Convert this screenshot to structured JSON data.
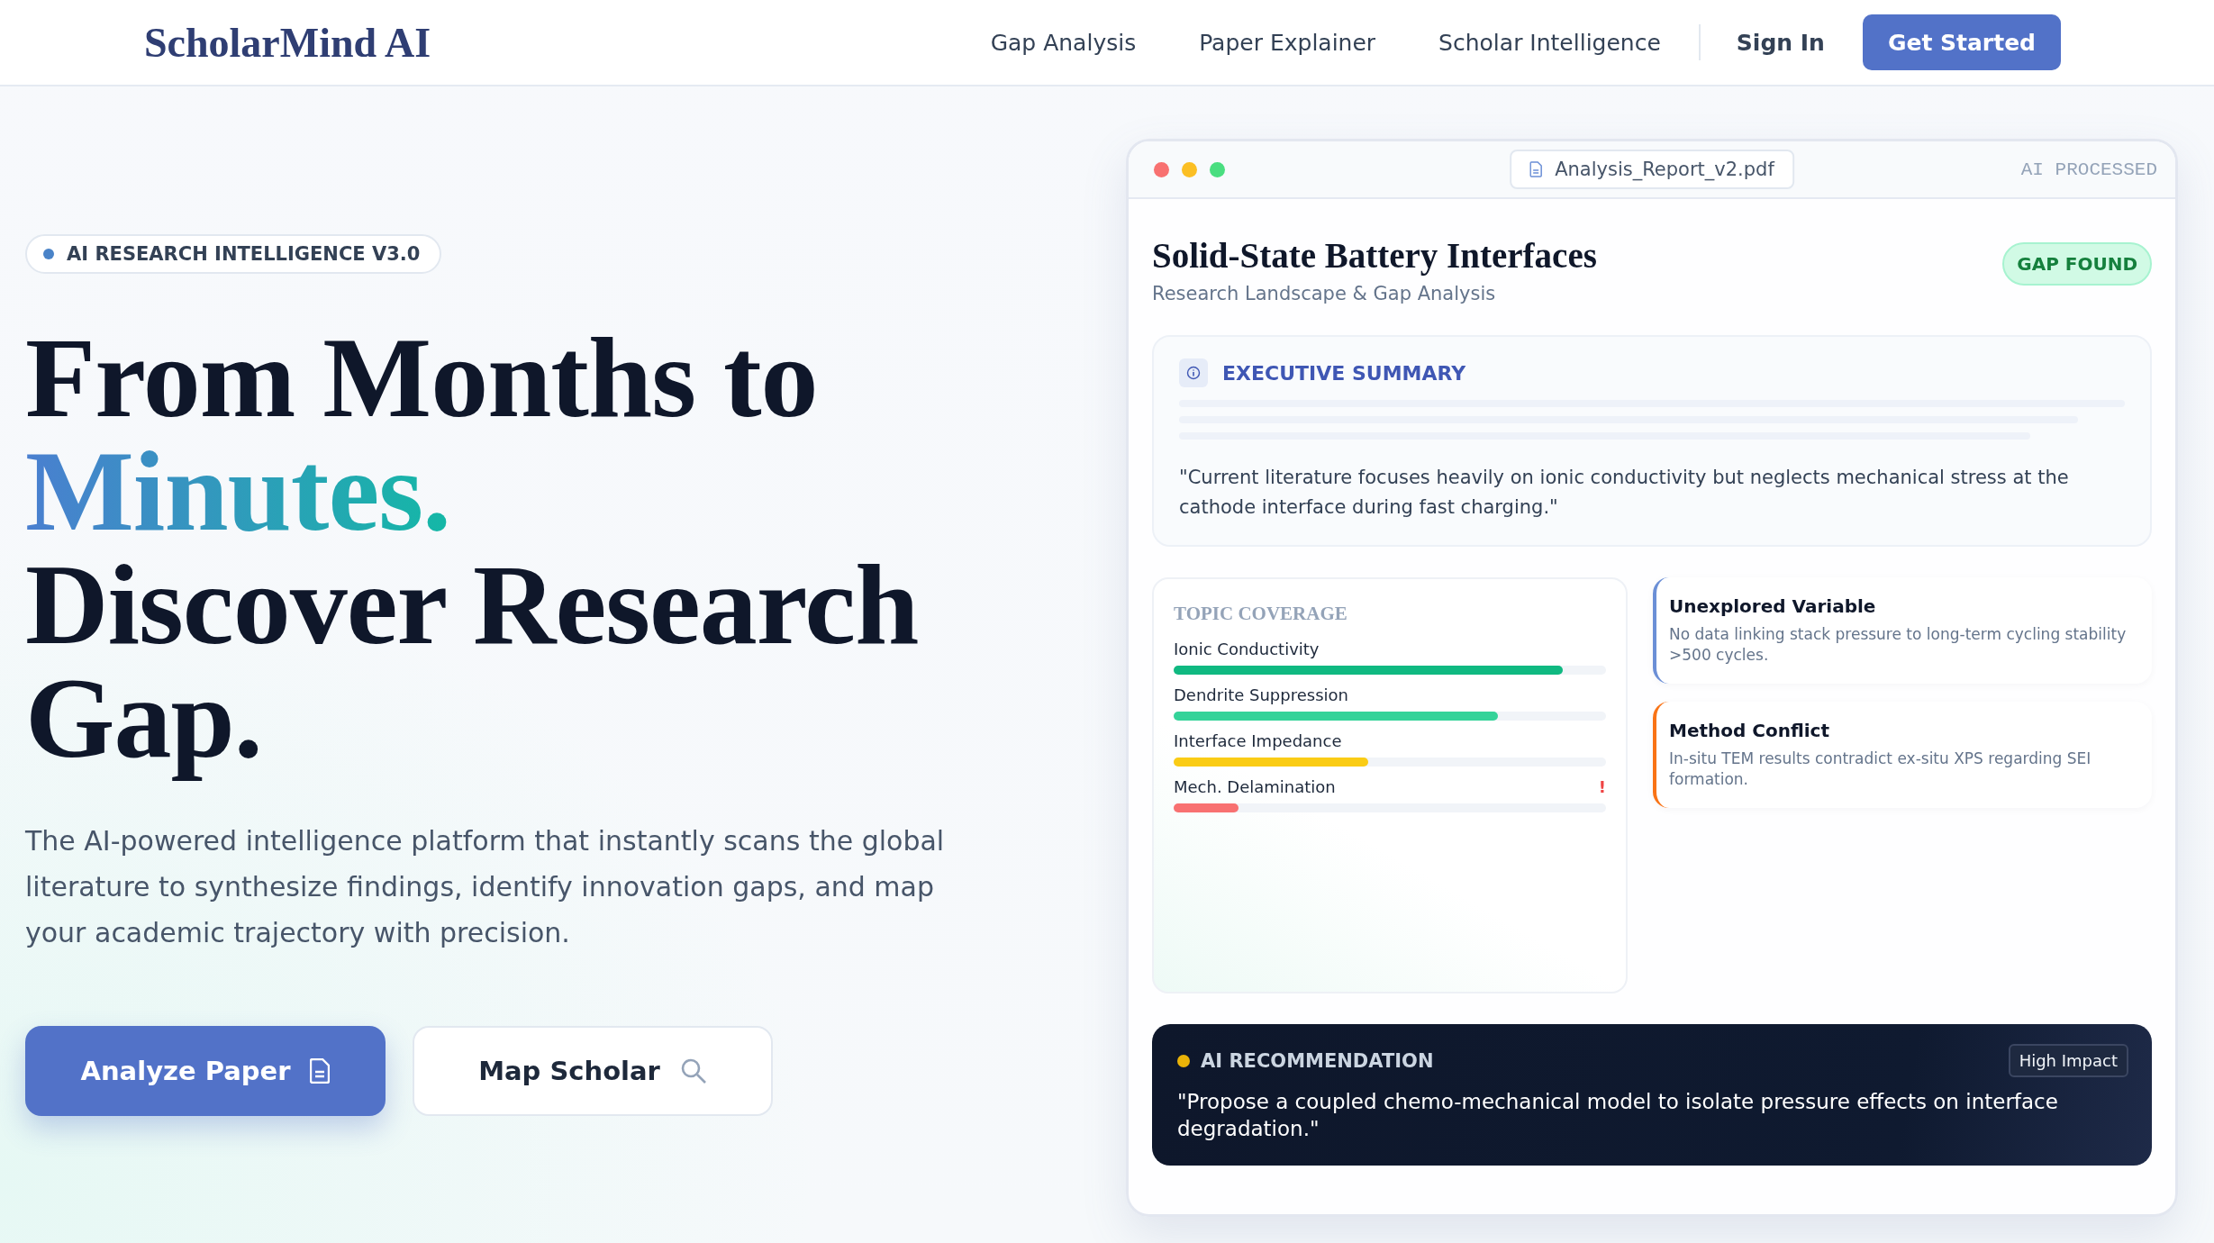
{
  "header": {
    "logo": "ScholarMind AI",
    "nav": [
      {
        "label": "Gap Analysis"
      },
      {
        "label": "Paper Explainer"
      },
      {
        "label": "Scholar Intelligence"
      }
    ],
    "sign_in": "Sign In",
    "cta": "Get Started"
  },
  "hero": {
    "badge": "AI RESEARCH INTELLIGENCE V3.0",
    "headline_start": "From Months to",
    "headline_highlight": "Minutes.",
    "headline_end": "Discover Research Gap.",
    "description": "The AI-powered intelligence platform that instantly scans the global literature to synthesize findings, identify innovation gaps, and map your academic trajectory with precision.",
    "buttons": [
      {
        "label": "Analyze Paper",
        "kind": "primary"
      },
      {
        "label": "Map Scholar",
        "kind": "secondary"
      }
    ]
  },
  "report": {
    "filename": "Analysis_Report_v2.pdf",
    "status": "AI PROCESSED",
    "title": "Solid-State Battery Interfaces",
    "subtitle": "Research Landscape & Gap Analysis",
    "badge": "GAP FOUND",
    "summary": {
      "heading": "EXECUTIVE SUMMARY",
      "quote": "\"Current literature focuses heavily on ionic conductivity but neglects mechanical stress at the cathode interface during fast charging.\""
    },
    "coverage": {
      "heading": "TOPIC COVERAGE",
      "topics": [
        {
          "name": "Ionic Conductivity",
          "level": 0.9,
          "color": "#10b981"
        },
        {
          "name": "Dendrite Suppression",
          "level": 0.75,
          "color": "#34d399"
        },
        {
          "name": "Interface Impedance",
          "level": 0.45,
          "color": "#facc15"
        },
        {
          "name": "Mech. Delamination",
          "level": 0.15,
          "color": "#f87171",
          "flag": "!"
        }
      ]
    },
    "findings": [
      {
        "title": "Unexplored Variable",
        "text": "No data linking stack pressure to long-term cycling stability >500 cycles.",
        "color": "#6b8fd6"
      },
      {
        "title": "Method Conflict",
        "text": "In-situ TEM results contradict ex-situ XPS regarding SEI formation.",
        "color": "#f97316"
      }
    ],
    "recommendation": {
      "heading": "AI RECOMMENDATION",
      "impact": "High Impact",
      "text": "\"Propose a coupled chemo-mechanical model to isolate pressure effects on interface degradation.\""
    }
  }
}
